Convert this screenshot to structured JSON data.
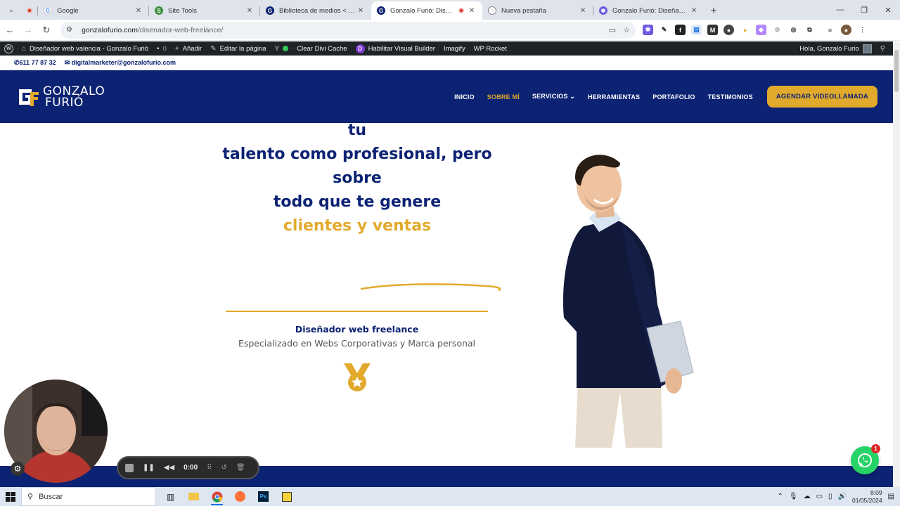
{
  "browser": {
    "tabs": [
      {
        "title": "",
        "favicon": "record-icon",
        "active": false
      },
      {
        "title": "Google",
        "favicon": "google-icon",
        "active": false
      },
      {
        "title": "Site Tools",
        "favicon": "sitetools-icon",
        "active": false
      },
      {
        "title": "Biblioteca de medios < Diseñad",
        "favicon": "gf-icon",
        "active": false
      },
      {
        "title": "Gonzalo Furió: Diseñador w",
        "favicon": "gf-icon",
        "active": true
      },
      {
        "title": "Nueva pestaña",
        "favicon": "newtab-icon",
        "active": false
      },
      {
        "title": "Gonzalo Furió: Diseñador web f",
        "favicon": "gear-icon",
        "active": false
      }
    ],
    "url_host": "gonzalofurio.com",
    "url_path": "/disenador-web-freelance/"
  },
  "wpbar": {
    "site_name": "Diseñador web valencia - Gonzalo Furió",
    "comments": "0",
    "add": "Añadir",
    "edit": "Editar la página",
    "clear_cache": "Clear Divi Cache",
    "visual_builder": "Habilitar Visual Builder",
    "imagify": "Imagify",
    "wp_rocket": "WP Rocket",
    "greeting": "Hola, Gonzalo Furio"
  },
  "contact": {
    "phone": "611 77 87 32",
    "email": "digitalmarketer@gonzalofurio.com"
  },
  "header": {
    "logo_line1": "GONZALO",
    "logo_line2": "FURIÓ",
    "nav": [
      {
        "label": "INICIO",
        "active": false
      },
      {
        "label": "SOBRE MÍ",
        "active": true
      },
      {
        "label": "SERVICIOS",
        "active": false
      },
      {
        "label": "HERRAMIENTAS",
        "active": false
      },
      {
        "label": "PORTAFOLIO",
        "active": false
      },
      {
        "label": "TESTIMONIOS",
        "active": false
      }
    ],
    "cta": "AGENDAR VIDEOLLAMADA"
  },
  "hero": {
    "title_line1": "Voy a diseñarte una web que refleje tu",
    "title_line2": "talento como profesional, pero sobre",
    "title_line3": "todo que te genere",
    "title_accent": "clientes y ventas",
    "subtitle": "Diseñador web freelance",
    "subtitle2": "Especializado en Webs Corporativas y Marca personal"
  },
  "recorder": {
    "time": "0:00"
  },
  "whatsapp": {
    "badge": "1"
  },
  "taskbar": {
    "search_placeholder": "Buscar",
    "time": "8:09",
    "date": "01/05/2024"
  },
  "colors": {
    "brand_blue": "#0c2273",
    "brand_gold": "#e2aa2d",
    "whatsapp": "#25d366"
  }
}
